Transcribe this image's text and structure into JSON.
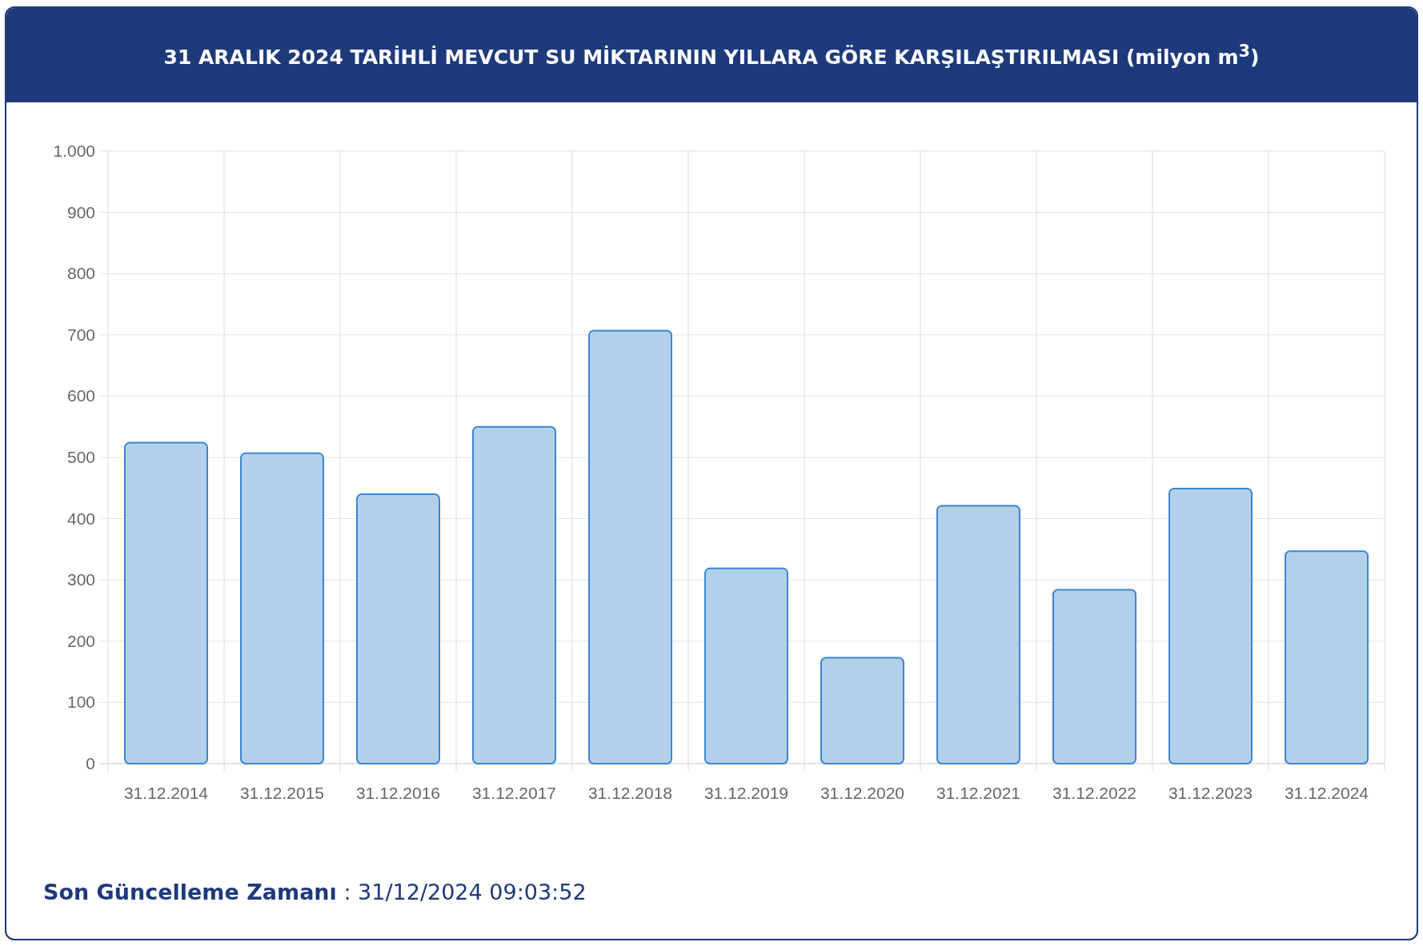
{
  "header": {
    "title": "31 ARALIK 2024 TARİHLİ MEVCUT SU MİKTARININ YILLARA GÖRE KARŞILAŞTIRILMASI (milyon m$^{3}$)"
  },
  "chart": {
    "chart_data": {
      "type": "bar",
      "categories": [
        "31.12.2014",
        "31.12.2015",
        "31.12.2016",
        "31.12.2017",
        "31.12.2018",
        "31.12.2019",
        "31.12.2020",
        "31.12.2021",
        "31.12.2022",
        "31.12.2023",
        "31.12.2024"
      ],
      "grid": true,
      "series": [
        {
          "color": "#b3d0ea",
          "values": [
            524,
            507,
            440,
            550,
            707,
            319,
            173,
            421,
            284,
            449,
            347
          ]
        }
      ],
      "ylim": [
        0,
        1000
      ],
      "yticks": [
        0,
        100,
        200,
        300,
        400,
        500,
        600,
        700,
        800,
        900,
        {
          "value": 1000,
          "label": "1.000"
        }
      ]
    }
  },
  "footer": {
    "update_text": "**Son Güncelleme Zamanı** : 31/12/2024 09:03:52"
  }
}
